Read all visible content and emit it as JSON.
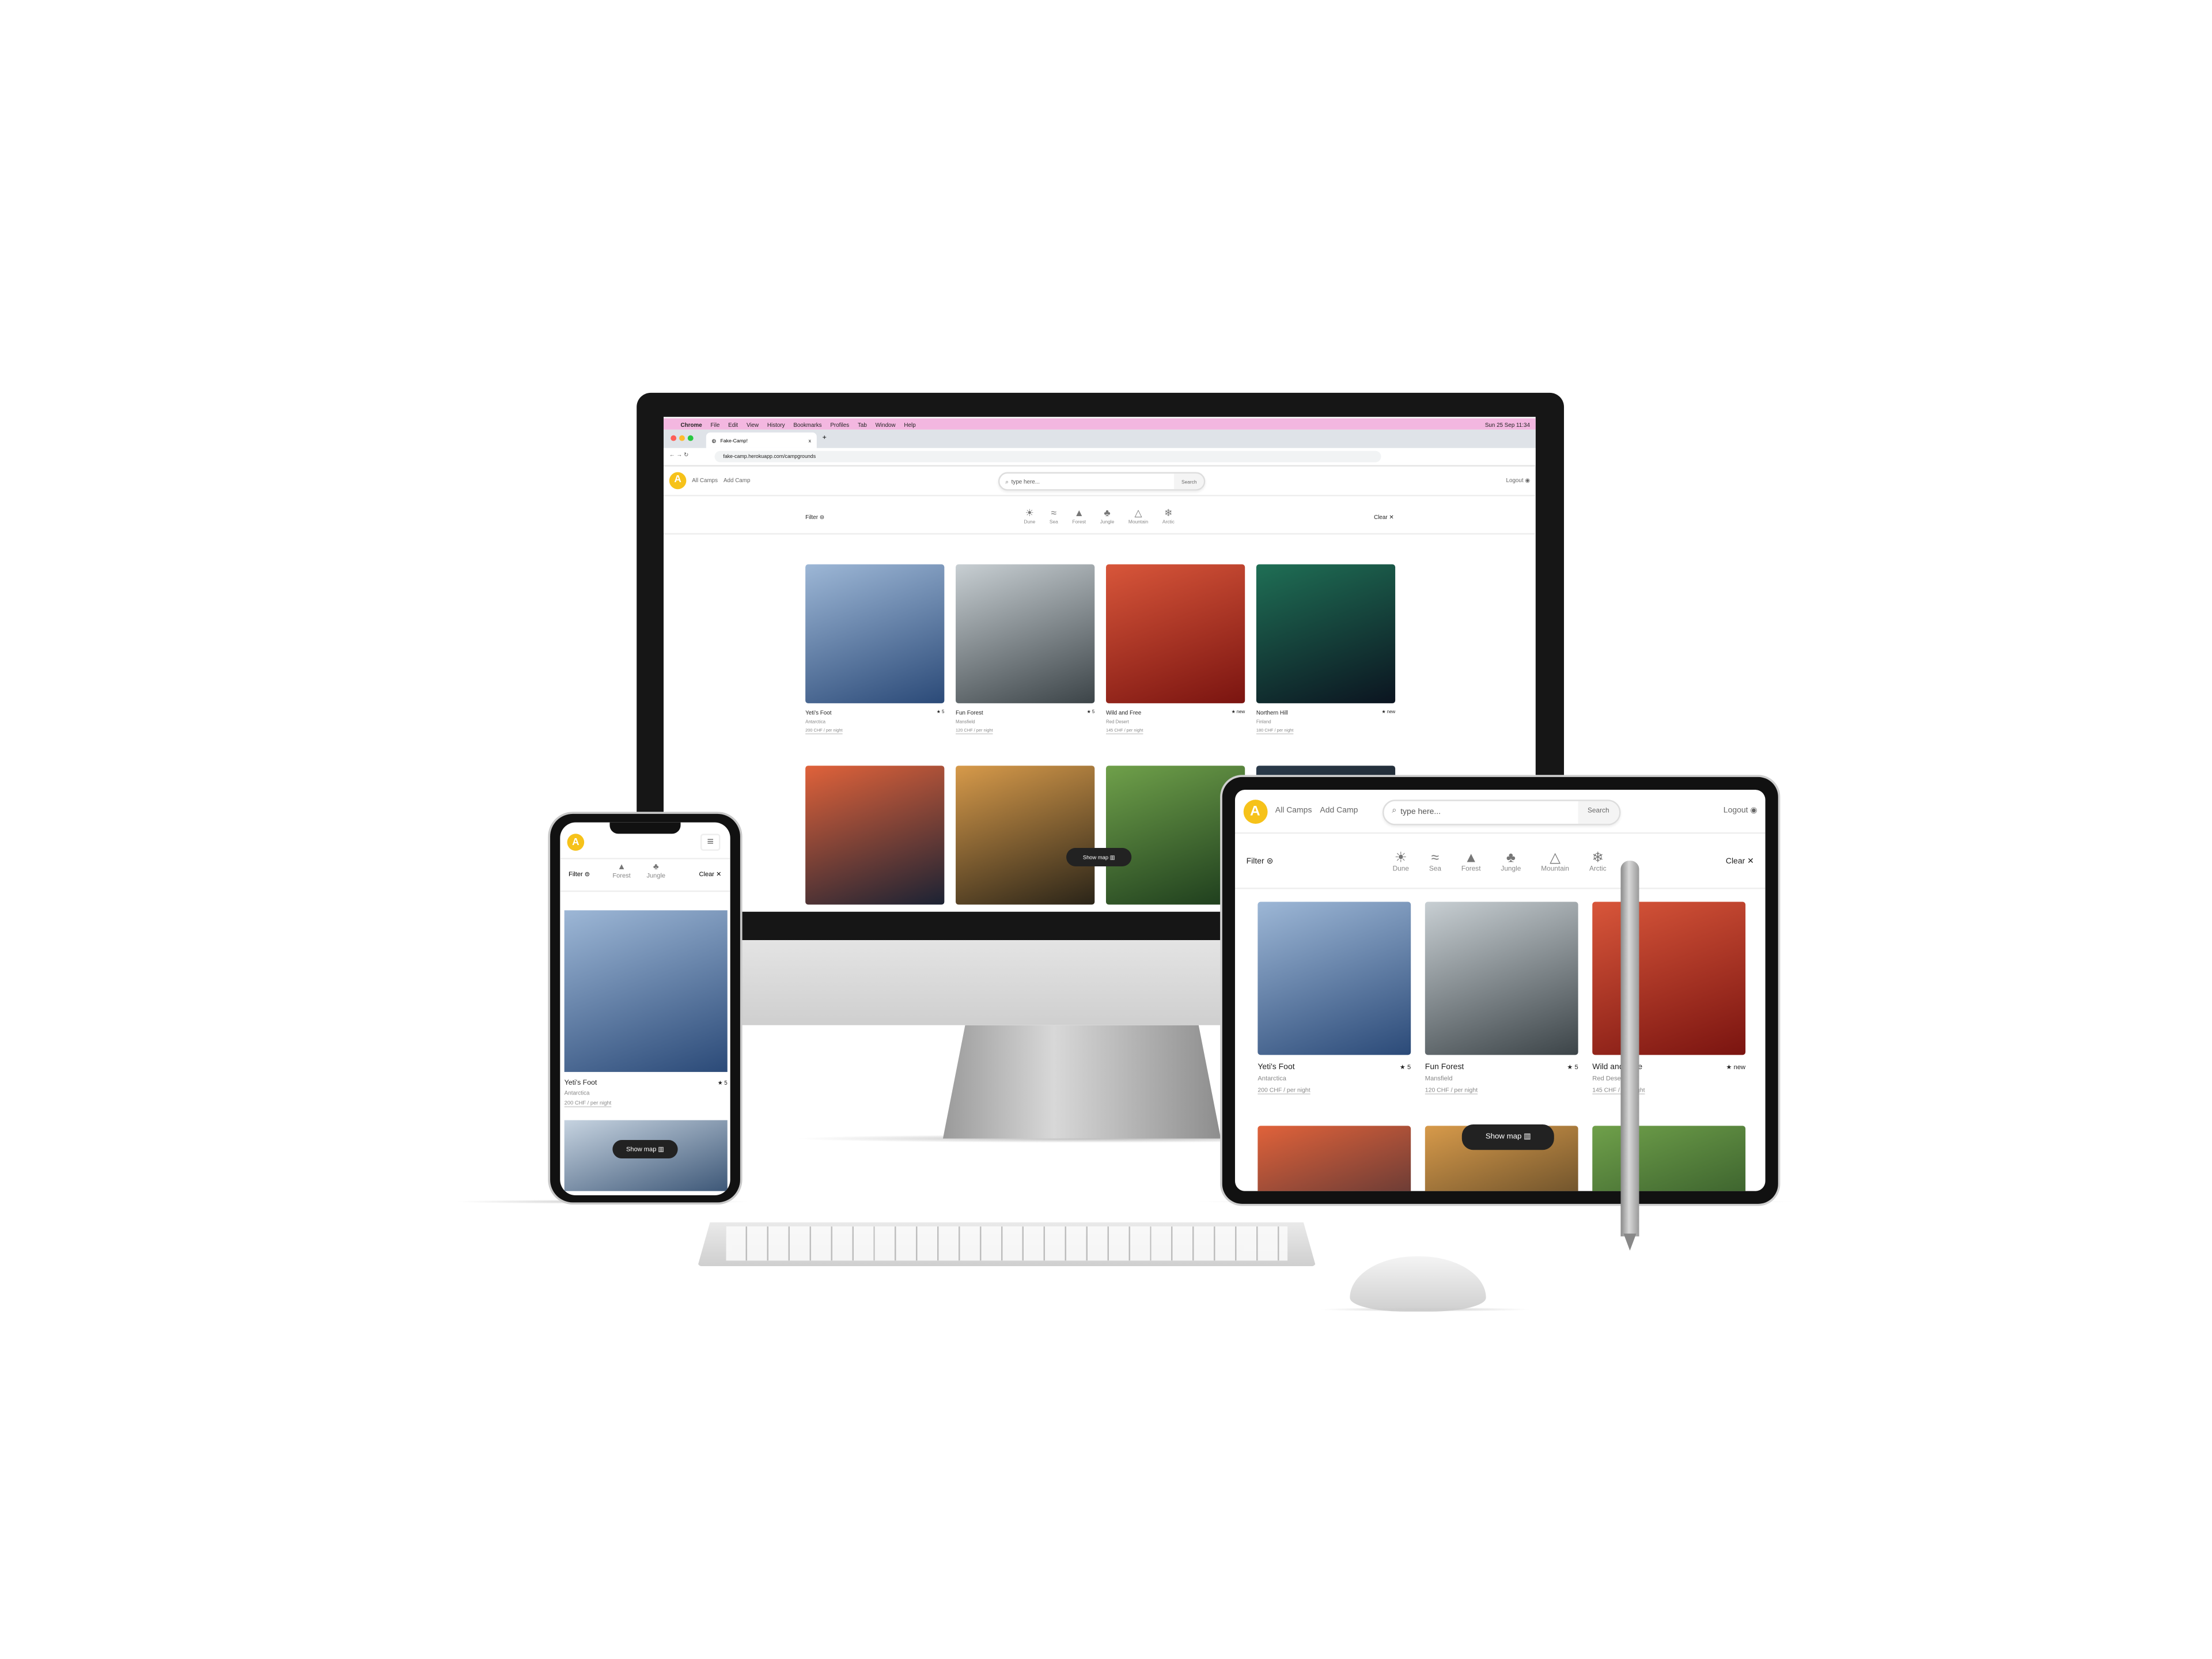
{
  "macos_menu": {
    "app": "Chrome",
    "items": [
      "File",
      "Edit",
      "View",
      "History",
      "Bookmarks",
      "Profiles",
      "Tab",
      "Window",
      "Help"
    ],
    "clock": "Sun 25 Sep 11:34"
  },
  "browser": {
    "tab_title": "Fake-Camp!",
    "tab_close": "x",
    "new_tab": "+",
    "url": "fake-camp.herokuapp.com/campgrounds"
  },
  "header": {
    "logo_glyph": "A",
    "nav": [
      "All Camps",
      "Add Camp"
    ],
    "search_placeholder": "type here...",
    "search_button": "Search",
    "logout": "Logout"
  },
  "filter": {
    "label": "Filter",
    "clear": "Clear",
    "categories": [
      {
        "label": "Dune",
        "icon": "dune-icon",
        "glyph": "☀"
      },
      {
        "label": "Sea",
        "icon": "sea-icon",
        "glyph": "≈"
      },
      {
        "label": "Forest",
        "icon": "forest-icon",
        "glyph": "▲"
      },
      {
        "label": "Jungle",
        "icon": "jungle-icon",
        "glyph": "♣"
      },
      {
        "label": "Mountain",
        "icon": "mountain-icon",
        "glyph": "△"
      },
      {
        "label": "Arctic",
        "icon": "arctic-icon",
        "glyph": "❄"
      }
    ]
  },
  "camps": [
    {
      "name": "Yeti's Foot",
      "rating": "★ 5",
      "location": "Antarctica",
      "price": "200 CHF / per night",
      "colors": [
        "#9db7d6",
        "#2b4a78"
      ]
    },
    {
      "name": "Fun Forest",
      "rating": "★ 5",
      "location": "Mansfield",
      "price": "120 CHF / per night",
      "colors": [
        "#c8cfd3",
        "#3c4448"
      ]
    },
    {
      "name": "Wild and Free",
      "rating": "★ new",
      "location": "Red Desert",
      "price": "145 CHF / per night",
      "colors": [
        "#d8563a",
        "#7a1410"
      ]
    },
    {
      "name": "Northern Hill",
      "rating": "★ new",
      "location": "Finland",
      "price": "180 CHF / per night",
      "colors": [
        "#1f6f55",
        "#0b1420"
      ]
    }
  ],
  "row2_colors": [
    [
      "#e0623a",
      "#1b2233"
    ],
    [
      "#d79a4a",
      "#2a2418"
    ],
    [
      "#6fa04a",
      "#1c3b1c"
    ],
    [
      "#2a3a4a",
      "#111"
    ]
  ],
  "show_map": "Show map ▥"
}
